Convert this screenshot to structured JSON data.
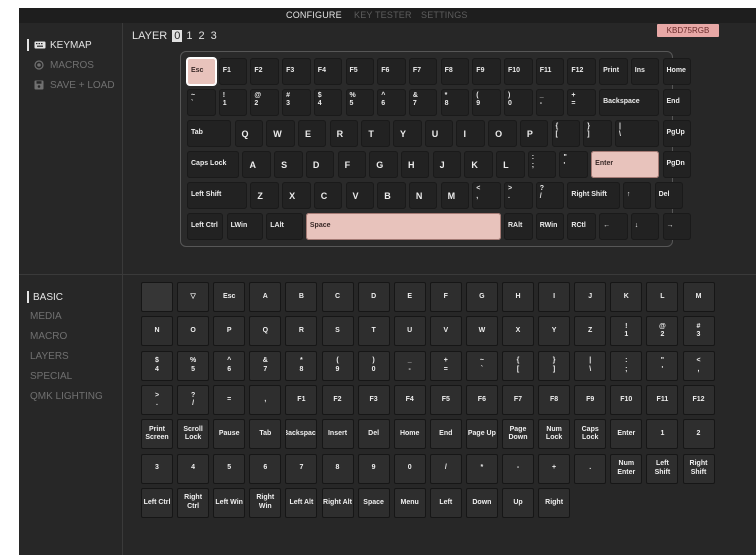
{
  "nav": {
    "tabs": [
      "CONFIGURE",
      "KEY TESTER",
      "SETTINGS"
    ],
    "active": "CONFIGURE"
  },
  "sidebar": {
    "items": [
      {
        "label": "KEYMAP",
        "icon": "keyboard-icon",
        "active": true
      },
      {
        "label": "MACROS",
        "icon": "macro-record-icon",
        "active": false
      },
      {
        "label": "SAVE + LOAD",
        "icon": "floppy-disk-icon",
        "active": false
      }
    ]
  },
  "keymap": {
    "layer_label": "LAYER",
    "layers": [
      "0",
      "1",
      "2",
      "3"
    ],
    "active_layer": "0",
    "device_badge": "KBD75RGB",
    "rows": [
      [
        [
          "Esc"
        ],
        [
          "F1"
        ],
        [
          "F2"
        ],
        [
          "F3"
        ],
        [
          "F4"
        ],
        [
          "F5"
        ],
        [
          "F6"
        ],
        [
          "F7"
        ],
        [
          "F8"
        ],
        [
          "F9"
        ],
        [
          "F10"
        ],
        [
          "F11"
        ],
        [
          "F12"
        ],
        [
          "Print"
        ],
        [
          "Ins"
        ],
        [
          "Home"
        ]
      ],
      [
        [
          "~",
          "`"
        ],
        [
          "!",
          "1"
        ],
        [
          "@",
          "2"
        ],
        [
          "#",
          "3"
        ],
        [
          "$",
          "4"
        ],
        [
          "%",
          "5"
        ],
        [
          "^",
          "6"
        ],
        [
          "&",
          "7"
        ],
        [
          "*",
          "8"
        ],
        [
          "(",
          "9"
        ],
        [
          ")",
          "0"
        ],
        [
          "_",
          "-"
        ],
        [
          "+",
          "="
        ],
        [
          "Backspace"
        ],
        [
          "End"
        ]
      ],
      [
        [
          "Tab"
        ],
        [
          "Q"
        ],
        [
          "W"
        ],
        [
          "E"
        ],
        [
          "R"
        ],
        [
          "T"
        ],
        [
          "Y"
        ],
        [
          "U"
        ],
        [
          "I"
        ],
        [
          "O"
        ],
        [
          "P"
        ],
        [
          "{",
          "["
        ],
        [
          "}",
          "]"
        ],
        [
          "|",
          "\\"
        ],
        [
          "PgUp"
        ]
      ],
      [
        [
          "Caps Lock"
        ],
        [
          "A"
        ],
        [
          "S"
        ],
        [
          "D"
        ],
        [
          "F"
        ],
        [
          "G"
        ],
        [
          "H"
        ],
        [
          "J"
        ],
        [
          "K"
        ],
        [
          "L"
        ],
        [
          ":",
          ";"
        ],
        [
          "\"",
          "'"
        ],
        [
          "Enter"
        ],
        [
          "PgDn"
        ]
      ],
      [
        [
          "Left Shift"
        ],
        [
          "Z"
        ],
        [
          "X"
        ],
        [
          "C"
        ],
        [
          "V"
        ],
        [
          "B"
        ],
        [
          "N"
        ],
        [
          "M"
        ],
        [
          "<",
          ","
        ],
        [
          ">",
          "."
        ],
        [
          "?",
          "/"
        ],
        [
          "Right Shift"
        ],
        [
          "↑"
        ],
        [
          "Del"
        ]
      ],
      [
        [
          "Left Ctrl"
        ],
        [
          "LWin"
        ],
        [
          "LAlt"
        ],
        [
          "Space"
        ],
        [
          "RAlt"
        ],
        [
          "RWin"
        ],
        [
          "RCtl"
        ],
        [
          "←"
        ],
        [
          "↓"
        ],
        [
          "→"
        ]
      ]
    ],
    "pink_keys": [
      "Esc",
      "Enter",
      "Space"
    ],
    "selected_key": "Esc"
  },
  "categories": {
    "items": [
      "BASIC",
      "MEDIA",
      "MACRO",
      "LAYERS",
      "SPECIAL",
      "QMK LIGHTING"
    ],
    "active": "BASIC"
  },
  "palette": {
    "rows": [
      [
        [
          ""
        ],
        [
          "▽"
        ],
        [
          "Esc"
        ],
        [
          "A"
        ],
        [
          "B"
        ],
        [
          "C"
        ],
        [
          "D"
        ],
        [
          "E"
        ],
        [
          "F"
        ],
        [
          "G"
        ],
        [
          "H"
        ],
        [
          "I"
        ],
        [
          "J"
        ],
        [
          "K"
        ],
        [
          "L"
        ],
        [
          "M"
        ]
      ],
      [
        [
          "N"
        ],
        [
          "O"
        ],
        [
          "P"
        ],
        [
          "Q"
        ],
        [
          "R"
        ],
        [
          "S"
        ],
        [
          "T"
        ],
        [
          "U"
        ],
        [
          "V"
        ],
        [
          "W"
        ],
        [
          "X"
        ],
        [
          "Y"
        ],
        [
          "Z"
        ],
        [
          "!",
          "1"
        ],
        [
          "@",
          "2"
        ],
        [
          "#",
          "3"
        ]
      ],
      [
        [
          "$",
          "4"
        ],
        [
          "%",
          "5"
        ],
        [
          "^",
          "6"
        ],
        [
          "&",
          "7"
        ],
        [
          "*",
          "8"
        ],
        [
          "(",
          "9"
        ],
        [
          ")",
          "0"
        ],
        [
          "_",
          "-"
        ],
        [
          "+",
          "="
        ],
        [
          "~",
          "`"
        ],
        [
          "{",
          "["
        ],
        [
          "}",
          "]"
        ],
        [
          "|",
          "\\"
        ],
        [
          ":",
          ";"
        ],
        [
          "\"",
          "'"
        ],
        [
          "<",
          ","
        ]
      ],
      [
        [
          ">",
          "."
        ],
        [
          "?",
          "/"
        ],
        [
          "="
        ],
        [
          ","
        ],
        [
          "F1"
        ],
        [
          "F2"
        ],
        [
          "F3"
        ],
        [
          "F4"
        ],
        [
          "F5"
        ],
        [
          "F6"
        ],
        [
          "F7"
        ],
        [
          "F8"
        ],
        [
          "F9"
        ],
        [
          "F10"
        ],
        [
          "F11"
        ],
        [
          "F12"
        ]
      ],
      [
        [
          "Print",
          "Screen"
        ],
        [
          "Scroll",
          "Lock"
        ],
        [
          "Pause"
        ],
        [
          "Tab"
        ],
        [
          "Backspace"
        ],
        [
          "Insert"
        ],
        [
          "Del"
        ],
        [
          "Home"
        ],
        [
          "End"
        ],
        [
          "Page Up"
        ],
        [
          "Page",
          "Down"
        ],
        [
          "Num",
          "Lock"
        ],
        [
          "Caps",
          "Lock"
        ],
        [
          "Enter"
        ],
        [
          "1"
        ],
        [
          "2"
        ]
      ],
      [
        [
          "3"
        ],
        [
          "4"
        ],
        [
          "5"
        ],
        [
          "6"
        ],
        [
          "7"
        ],
        [
          "8"
        ],
        [
          "9"
        ],
        [
          "0"
        ],
        [
          "/"
        ],
        [
          "*"
        ],
        [
          "-"
        ],
        [
          "+"
        ],
        [
          "."
        ],
        [
          "Num",
          "Enter"
        ],
        [
          "Left",
          "Shift"
        ],
        [
          "Right",
          "Shift"
        ]
      ],
      [
        [
          "Left Ctrl"
        ],
        [
          "Right",
          "Ctrl"
        ],
        [
          "Left Win"
        ],
        [
          "Right",
          "Win"
        ],
        [
          "Left Alt"
        ],
        [
          "Right Alt"
        ],
        [
          "Space"
        ],
        [
          "Menu"
        ],
        [
          "Left"
        ],
        [
          "Down"
        ],
        [
          "Up"
        ],
        [
          "Right"
        ]
      ]
    ]
  },
  "colors": {
    "accent_pink": "#e8c3bc",
    "badge_pink": "#e8a8a6",
    "background": "#272727",
    "key": "#222222"
  }
}
